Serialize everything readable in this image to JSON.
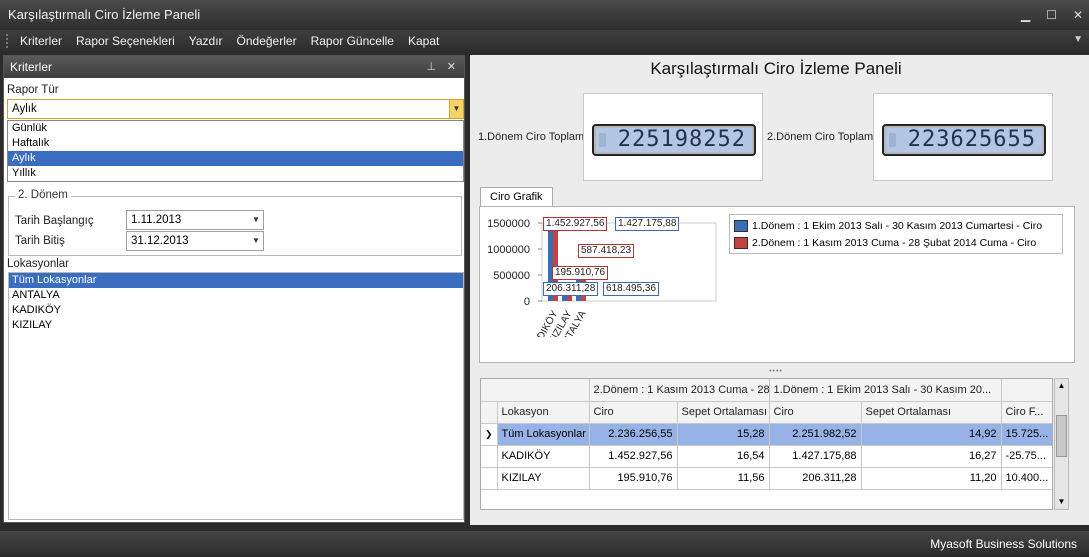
{
  "window": {
    "title": "Karşılaştırmalı Ciro İzleme Paneli"
  },
  "menu": [
    "Kriterler",
    "Rapor Seçenekleri",
    "Yazdır",
    "Öndeğerler",
    "Rapor Güncelle",
    "Kapat"
  ],
  "left": {
    "panel_title": "Kriterler",
    "rapor_tur_label": "Rapor Tür",
    "rapor_tur_value": "Aylık",
    "rapor_tur_options": [
      "Günlük",
      "Haftalık",
      "Aylık",
      "Yıllık"
    ],
    "selected_option": "Aylık",
    "donem2_title": "2. Dönem",
    "tarih_baslangic_label": "Tarih Başlangıç",
    "tarih_baslangic_value": "1.11.2013",
    "tarih_bitis_label": "Tarih Bitiş",
    "tarih_bitis_value": "31.12.2013",
    "lokasyon_label": "Lokasyonlar",
    "lokasyonlar": [
      "Tüm Lokasyonlar",
      "ANTALYA",
      "KADIKÖY",
      "KIZILAY"
    ],
    "selected_lokasyon": "Tüm Lokasyonlar"
  },
  "right": {
    "title": "Karşılaştırmalı Ciro İzleme Paneli",
    "donem1_label": "1.Dönem Ciro Toplam",
    "donem1_value": "225198252",
    "donem2_label": "2.Dönem Ciro Toplam",
    "donem2_value": "223625655",
    "chart_tab": "Ciro Grafik"
  },
  "colors": {
    "series1": "#3c6eb4",
    "series2": "#c14444",
    "selection": "#3a6dbf"
  },
  "chart_data": {
    "type": "bar",
    "categories": [
      "KADIKÖY",
      "KIZILAY",
      "ANTALYA"
    ],
    "series": [
      {
        "name": "1.Dönem : 1 Ekim 2013 Salı - 30 Kasım 2013 Cumartesi - Ciro",
        "values": [
          1427175.88,
          206311.28,
          618495.36
        ],
        "labels": [
          "1.427.175,88",
          "206.311,28",
          "618.495,36"
        ]
      },
      {
        "name": "2.Dönem : 1 Kasım 2013 Cuma - 28 Şubat 2014 Cuma - Ciro",
        "values": [
          1452927.56,
          195910.76,
          587418.23
        ],
        "labels": [
          "1.452.927,56",
          "195.910,76",
          "587.418,23"
        ]
      }
    ],
    "yticks": [
      "1500000",
      "1000000",
      "500000",
      "0"
    ],
    "ylim": [
      0,
      1500000
    ],
    "legend": "right"
  },
  "grid": {
    "band1": "2.Dönem : 1 Kasım 2013 Cuma - 28 ...",
    "band2": "1.Dönem : 1 Ekim 2013 Salı - 30 Kasım 20...",
    "columns": [
      "Lokasyon",
      "Ciro",
      "Sepet Ortalaması",
      "Ciro",
      "Sepet Ortalaması",
      "Ciro F..."
    ],
    "rows": [
      [
        "Tüm Lokasyonlar",
        "2.236.256,55",
        "15,28",
        "2.251.982,52",
        "14,92",
        "15.725..."
      ],
      [
        "KADIKÖY",
        "1.452.927,56",
        "16,54",
        "1.427.175,88",
        "16,27",
        "-25.75..."
      ],
      [
        "KIZILAY",
        "195.910,76",
        "11,56",
        "206.311,28",
        "11,20",
        "10.400..."
      ]
    ]
  },
  "status": "Myasoft Business Solutions"
}
